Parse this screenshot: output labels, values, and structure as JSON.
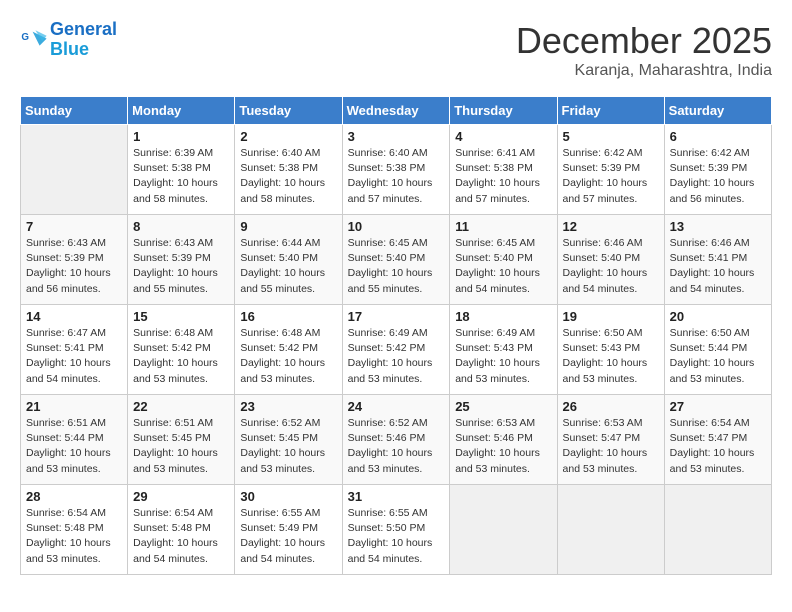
{
  "header": {
    "logo_line1": "General",
    "logo_line2": "Blue",
    "month": "December 2025",
    "location": "Karanja, Maharashtra, India"
  },
  "weekdays": [
    "Sunday",
    "Monday",
    "Tuesday",
    "Wednesday",
    "Thursday",
    "Friday",
    "Saturday"
  ],
  "weeks": [
    [
      {
        "day": "",
        "info": ""
      },
      {
        "day": "1",
        "info": "Sunrise: 6:39 AM\nSunset: 5:38 PM\nDaylight: 10 hours\nand 58 minutes."
      },
      {
        "day": "2",
        "info": "Sunrise: 6:40 AM\nSunset: 5:38 PM\nDaylight: 10 hours\nand 58 minutes."
      },
      {
        "day": "3",
        "info": "Sunrise: 6:40 AM\nSunset: 5:38 PM\nDaylight: 10 hours\nand 57 minutes."
      },
      {
        "day": "4",
        "info": "Sunrise: 6:41 AM\nSunset: 5:38 PM\nDaylight: 10 hours\nand 57 minutes."
      },
      {
        "day": "5",
        "info": "Sunrise: 6:42 AM\nSunset: 5:39 PM\nDaylight: 10 hours\nand 57 minutes."
      },
      {
        "day": "6",
        "info": "Sunrise: 6:42 AM\nSunset: 5:39 PM\nDaylight: 10 hours\nand 56 minutes."
      }
    ],
    [
      {
        "day": "7",
        "info": "Sunrise: 6:43 AM\nSunset: 5:39 PM\nDaylight: 10 hours\nand 56 minutes."
      },
      {
        "day": "8",
        "info": "Sunrise: 6:43 AM\nSunset: 5:39 PM\nDaylight: 10 hours\nand 55 minutes."
      },
      {
        "day": "9",
        "info": "Sunrise: 6:44 AM\nSunset: 5:40 PM\nDaylight: 10 hours\nand 55 minutes."
      },
      {
        "day": "10",
        "info": "Sunrise: 6:45 AM\nSunset: 5:40 PM\nDaylight: 10 hours\nand 55 minutes."
      },
      {
        "day": "11",
        "info": "Sunrise: 6:45 AM\nSunset: 5:40 PM\nDaylight: 10 hours\nand 54 minutes."
      },
      {
        "day": "12",
        "info": "Sunrise: 6:46 AM\nSunset: 5:40 PM\nDaylight: 10 hours\nand 54 minutes."
      },
      {
        "day": "13",
        "info": "Sunrise: 6:46 AM\nSunset: 5:41 PM\nDaylight: 10 hours\nand 54 minutes."
      }
    ],
    [
      {
        "day": "14",
        "info": "Sunrise: 6:47 AM\nSunset: 5:41 PM\nDaylight: 10 hours\nand 54 minutes."
      },
      {
        "day": "15",
        "info": "Sunrise: 6:48 AM\nSunset: 5:42 PM\nDaylight: 10 hours\nand 53 minutes."
      },
      {
        "day": "16",
        "info": "Sunrise: 6:48 AM\nSunset: 5:42 PM\nDaylight: 10 hours\nand 53 minutes."
      },
      {
        "day": "17",
        "info": "Sunrise: 6:49 AM\nSunset: 5:42 PM\nDaylight: 10 hours\nand 53 minutes."
      },
      {
        "day": "18",
        "info": "Sunrise: 6:49 AM\nSunset: 5:43 PM\nDaylight: 10 hours\nand 53 minutes."
      },
      {
        "day": "19",
        "info": "Sunrise: 6:50 AM\nSunset: 5:43 PM\nDaylight: 10 hours\nand 53 minutes."
      },
      {
        "day": "20",
        "info": "Sunrise: 6:50 AM\nSunset: 5:44 PM\nDaylight: 10 hours\nand 53 minutes."
      }
    ],
    [
      {
        "day": "21",
        "info": "Sunrise: 6:51 AM\nSunset: 5:44 PM\nDaylight: 10 hours\nand 53 minutes."
      },
      {
        "day": "22",
        "info": "Sunrise: 6:51 AM\nSunset: 5:45 PM\nDaylight: 10 hours\nand 53 minutes."
      },
      {
        "day": "23",
        "info": "Sunrise: 6:52 AM\nSunset: 5:45 PM\nDaylight: 10 hours\nand 53 minutes."
      },
      {
        "day": "24",
        "info": "Sunrise: 6:52 AM\nSunset: 5:46 PM\nDaylight: 10 hours\nand 53 minutes."
      },
      {
        "day": "25",
        "info": "Sunrise: 6:53 AM\nSunset: 5:46 PM\nDaylight: 10 hours\nand 53 minutes."
      },
      {
        "day": "26",
        "info": "Sunrise: 6:53 AM\nSunset: 5:47 PM\nDaylight: 10 hours\nand 53 minutes."
      },
      {
        "day": "27",
        "info": "Sunrise: 6:54 AM\nSunset: 5:47 PM\nDaylight: 10 hours\nand 53 minutes."
      }
    ],
    [
      {
        "day": "28",
        "info": "Sunrise: 6:54 AM\nSunset: 5:48 PM\nDaylight: 10 hours\nand 53 minutes."
      },
      {
        "day": "29",
        "info": "Sunrise: 6:54 AM\nSunset: 5:48 PM\nDaylight: 10 hours\nand 54 minutes."
      },
      {
        "day": "30",
        "info": "Sunrise: 6:55 AM\nSunset: 5:49 PM\nDaylight: 10 hours\nand 54 minutes."
      },
      {
        "day": "31",
        "info": "Sunrise: 6:55 AM\nSunset: 5:50 PM\nDaylight: 10 hours\nand 54 minutes."
      },
      {
        "day": "",
        "info": ""
      },
      {
        "day": "",
        "info": ""
      },
      {
        "day": "",
        "info": ""
      }
    ]
  ]
}
